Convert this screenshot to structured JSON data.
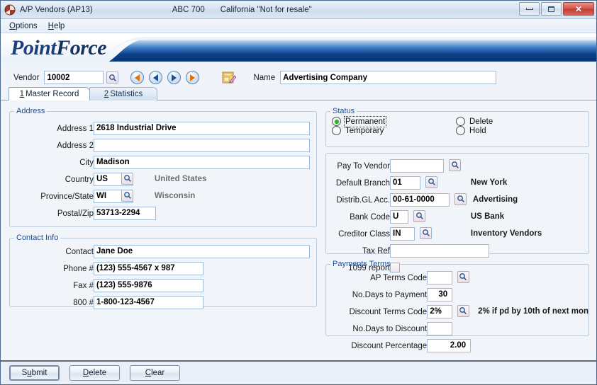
{
  "window": {
    "title": "A/P Vendors (AP13)",
    "company": "ABC 700",
    "state_note": "California \"Not for resale\"",
    "icon": "app-icon",
    "minimize_label": "–",
    "maximize_label": "□",
    "close_label": "✕"
  },
  "menu": {
    "items": [
      {
        "mnemonic": "O",
        "rest": "ptions"
      },
      {
        "mnemonic": "H",
        "rest": "elp"
      }
    ]
  },
  "brand": {
    "part1": "Point",
    "part2": "Force"
  },
  "header": {
    "vendor_label": "Vendor",
    "vendor_value": "10002",
    "vendor_lookup_icon": "magnifier-icon",
    "nav": [
      {
        "name": "first-record-button",
        "dir": "left",
        "accent": "orange"
      },
      {
        "name": "previous-record-button",
        "dir": "left",
        "accent": "blue"
      },
      {
        "name": "next-record-button",
        "dir": "right",
        "accent": "blue"
      },
      {
        "name": "last-record-button",
        "dir": "right",
        "accent": "orange"
      }
    ],
    "notes_icon": "notepad-pencil-icon",
    "name_label": "Name",
    "name_value": "Advertising Company"
  },
  "tabs": [
    {
      "mnemonic": "1",
      "label": "Master Record",
      "active": true
    },
    {
      "mnemonic": "2",
      "label": "Statistics",
      "active": false
    }
  ],
  "address": {
    "legend": "Address",
    "address1_label": "Address 1",
    "address1_value": "2618 Industrial Drive",
    "address2_label": "Address 2",
    "address2_value": "",
    "city_label": "City",
    "city_value": "Madison",
    "country_label": "Country",
    "country_value": "US",
    "country_desc": "United States",
    "province_label": "Province/State",
    "province_value": "WI",
    "province_desc": "Wisconsin",
    "postal_label": "Postal/Zip",
    "postal_value": "53713-2294"
  },
  "contact": {
    "legend": "Contact Info",
    "contact_label": "Contact",
    "contact_value": "Jane Doe",
    "phone_label": "Phone #",
    "phone_value": "(123) 555-4567 x 987",
    "fax_label": "Fax #",
    "fax_value": "(123) 555-9876",
    "tollfree_label": "800 #",
    "tollfree_value": "1-800-123-4567"
  },
  "status": {
    "legend": "Status",
    "options": [
      {
        "label": "Permanent",
        "selected": true
      },
      {
        "label": "Delete",
        "selected": false
      },
      {
        "label": "Temporary",
        "selected": false
      },
      {
        "label": "Hold",
        "selected": false
      }
    ],
    "selected_color": "#2db92d"
  },
  "accounting": {
    "pay_to_vendor_label": "Pay To Vendor",
    "pay_to_vendor_value": "",
    "default_branch_label": "Default Branch",
    "default_branch_value": "01",
    "default_branch_desc": "New York",
    "gl_acc_label": "Distrib.GL Acc.",
    "gl_acc_value": "00-61-0000",
    "gl_acc_desc": "Advertising",
    "bank_code_label": "Bank Code",
    "bank_code_value": "U",
    "bank_code_desc": "US Bank",
    "creditor_class_label": "Creditor Class",
    "creditor_class_value": "IN",
    "creditor_class_desc": "Inventory Vendors",
    "tax_ref_label": "Tax Ref",
    "tax_ref_value": "",
    "report_1099_label": "1099 report",
    "report_1099_checked": false
  },
  "payment_terms": {
    "legend": "Payments Terms",
    "ap_terms_label": "AP Terms Code",
    "ap_terms_value": "",
    "days_to_payment_label": "No.Days to Payment",
    "days_to_payment_value": "30",
    "discount_terms_label": "Discount Terms Code",
    "discount_terms_value": "2%",
    "discount_terms_desc": "2% if pd by 10th of next mon",
    "days_to_discount_label": "No.Days to Discount",
    "days_to_discount_value": "",
    "discount_pct_label": "Discount Percentage",
    "discount_pct_value": "2.00"
  },
  "footer": {
    "buttons": [
      {
        "mnemonic_pre": "S",
        "mnemonic": "u",
        "mnemonic_post": "bmit",
        "name": "submit-button"
      },
      {
        "mnemonic_pre": "",
        "mnemonic": "D",
        "mnemonic_post": "elete",
        "name": "delete-button"
      },
      {
        "mnemonic_pre": "",
        "mnemonic": "C",
        "mnemonic_post": "lear",
        "name": "clear-button"
      }
    ],
    "submit_label": "Submit",
    "delete_label": "Delete",
    "clear_label": "Clear"
  },
  "colors": {
    "accent_blue": "#1a3f7a",
    "legend_blue": "#1b4f9c",
    "nav_orange": "#e2700c",
    "close_red": "#bf3c31",
    "body_bg": "#f1f5fa"
  }
}
